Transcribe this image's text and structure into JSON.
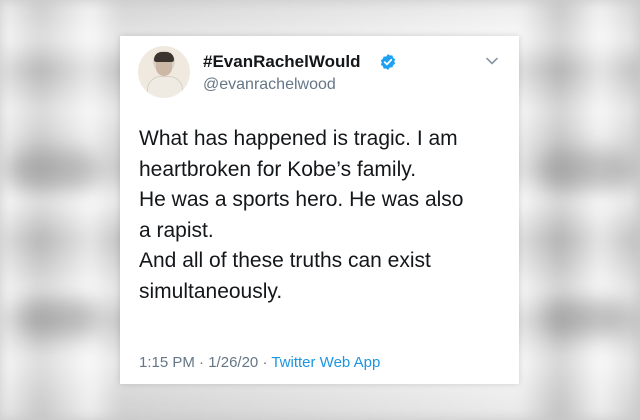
{
  "tweet": {
    "display_name": "#EvanRachelWould",
    "handle": "@evanrachelwood",
    "text_lines": [
      "What has happened is tragic. I am",
      "heartbroken for Kobe’s family.",
      "He was a sports hero. He was also",
      "a rapist.",
      "And all of these truths can exist",
      "simultaneously."
    ],
    "time": "1:15 PM",
    "separator": "·",
    "date": "1/26/20",
    "source": "Twitter Web App"
  },
  "icons": {
    "verified": "verified-badge-icon",
    "menu": "chevron-down-icon"
  },
  "colors": {
    "verified_blue": "#1da1f2",
    "link_blue": "#1b95e0",
    "secondary_text": "#657786",
    "primary_text": "#14171a"
  }
}
